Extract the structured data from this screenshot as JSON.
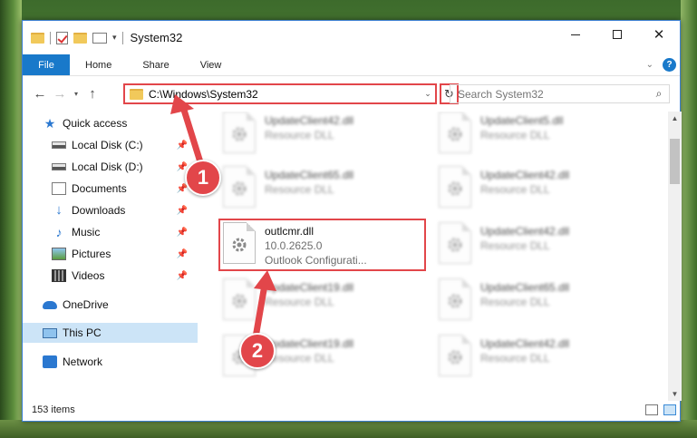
{
  "window": {
    "title": "System32"
  },
  "ribbon": {
    "tabs": [
      "File",
      "Home",
      "Share",
      "View"
    ]
  },
  "address": {
    "path": "C:\\Windows\\System32"
  },
  "search": {
    "placeholder": "Search System32"
  },
  "sidebar": {
    "items": [
      {
        "label": "Quick access",
        "icon": "star-icon",
        "pinned": false
      },
      {
        "label": "Local Disk (C:)",
        "icon": "disk-icon",
        "pinned": true
      },
      {
        "label": "Local Disk (D:)",
        "icon": "disk-icon",
        "pinned": true
      },
      {
        "label": "Documents",
        "icon": "documents-icon",
        "pinned": true
      },
      {
        "label": "Downloads",
        "icon": "download-icon",
        "pinned": true
      },
      {
        "label": "Music",
        "icon": "music-icon",
        "pinned": true
      },
      {
        "label": "Pictures",
        "icon": "pictures-icon",
        "pinned": true
      },
      {
        "label": "Videos",
        "icon": "videos-icon",
        "pinned": true
      },
      {
        "label": "OneDrive",
        "icon": "cloud-icon",
        "pinned": false
      },
      {
        "label": "This PC",
        "icon": "computer-icon",
        "pinned": false,
        "selected": true
      },
      {
        "label": "Network",
        "icon": "network-icon",
        "pinned": false
      }
    ]
  },
  "files": [
    {
      "name": "UpdateClient42.dll",
      "sub1": "Resource DLL",
      "sub2": ""
    },
    {
      "name": "UpdateClient5.dll",
      "sub1": "Resource DLL",
      "sub2": ""
    },
    {
      "name": "UpdateClient65.dll",
      "sub1": "Resource DLL",
      "sub2": ""
    },
    {
      "name": "UpdateClient42.dll",
      "sub1": "Resource DLL",
      "sub2": ""
    },
    {
      "name": "outlcmr.dll",
      "sub1": "10.0.2625.0",
      "sub2": "Outlook Configurati..."
    },
    {
      "name": "UpdateClient42.dll",
      "sub1": "Resource DLL",
      "sub2": ""
    },
    {
      "name": "UpdateClient19.dll",
      "sub1": "Resource DLL",
      "sub2": ""
    },
    {
      "name": "UpdateClient65.dll",
      "sub1": "Resource DLL",
      "sub2": ""
    },
    {
      "name": "UpdateClient19.dll",
      "sub1": "Resource DLL",
      "sub2": ""
    },
    {
      "name": "UpdateClient42.dll",
      "sub1": "Resource DLL",
      "sub2": ""
    }
  ],
  "status": {
    "count": "153 items"
  },
  "callouts": [
    "1",
    "2"
  ],
  "colors": {
    "accent": "#1979ca",
    "highlight": "#e2464a",
    "selection": "#cce4f7"
  }
}
